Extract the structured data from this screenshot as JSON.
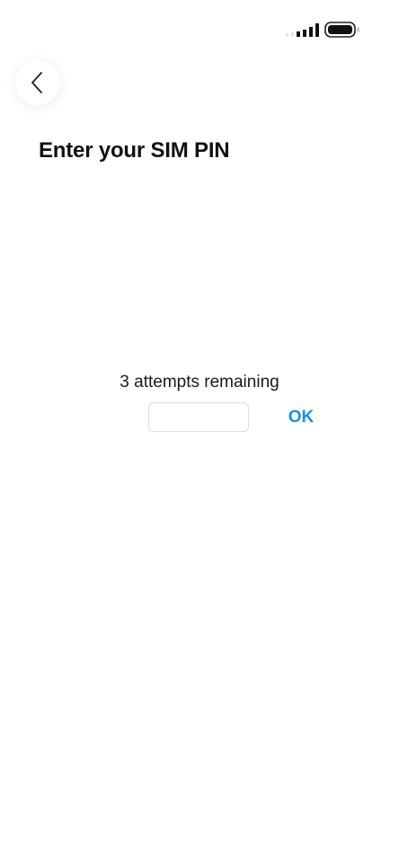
{
  "header": {
    "title": "Enter your SIM PIN",
    "back_icon": "chevron-left-icon"
  },
  "status_bar": {
    "signal_icon": "signal-bars-icon",
    "battery_icon": "battery-icon",
    "signal_level": 4,
    "signal_max": 6,
    "battery_level": 0.9
  },
  "pin": {
    "attempts_text": "3 attempts remaining",
    "value": "",
    "placeholder": ""
  },
  "actions": {
    "ok_label": "OK"
  },
  "colors": {
    "accent": "#1a8fe0",
    "title": "#111111",
    "input_border": "#dcdcdc"
  }
}
